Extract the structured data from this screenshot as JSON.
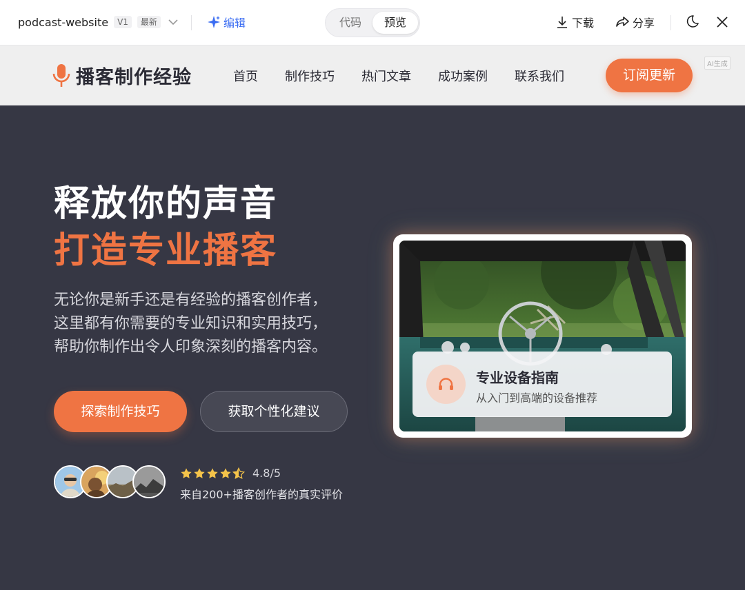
{
  "app": {
    "project_name": "podcast-website",
    "version": "V1",
    "latest_tag": "最新",
    "edit_label": "编辑",
    "tabs": [
      {
        "label": "代码"
      },
      {
        "label": "预览",
        "active": true
      }
    ],
    "download_label": "下载",
    "share_label": "分享"
  },
  "site": {
    "logo_text": "播客制作经验",
    "nav": [
      {
        "label": "首页"
      },
      {
        "label": "制作技巧"
      },
      {
        "label": "热门文章"
      },
      {
        "label": "成功案例"
      },
      {
        "label": "联系我们"
      }
    ],
    "subscribe_label": "订阅更新",
    "ai_badge": "AI生成"
  },
  "hero": {
    "title_line1": "释放你的声音",
    "title_line2": "打造专业播客",
    "description_lines": [
      "无论你是新手还是有经验的播客创作者，",
      "这里都有你需要的专业知识和实用技巧，",
      "帮助你制作出令人印象深刻的播客内容。"
    ],
    "primary_button": "探索制作技巧",
    "secondary_button": "获取个性化建议",
    "rating_score": "4.8/5",
    "rating_value": 4.5,
    "rating_max": 5,
    "rating_text": "来自200+播客创作者的真实评价"
  },
  "feature_card": {
    "title": "专业设备指南",
    "subtitle": "从入门到高端的设备推荐"
  },
  "colors": {
    "accent": "#ef7443",
    "hero_bg": "#363744",
    "link_blue": "#3b6df2",
    "star": "#f4c34a"
  }
}
